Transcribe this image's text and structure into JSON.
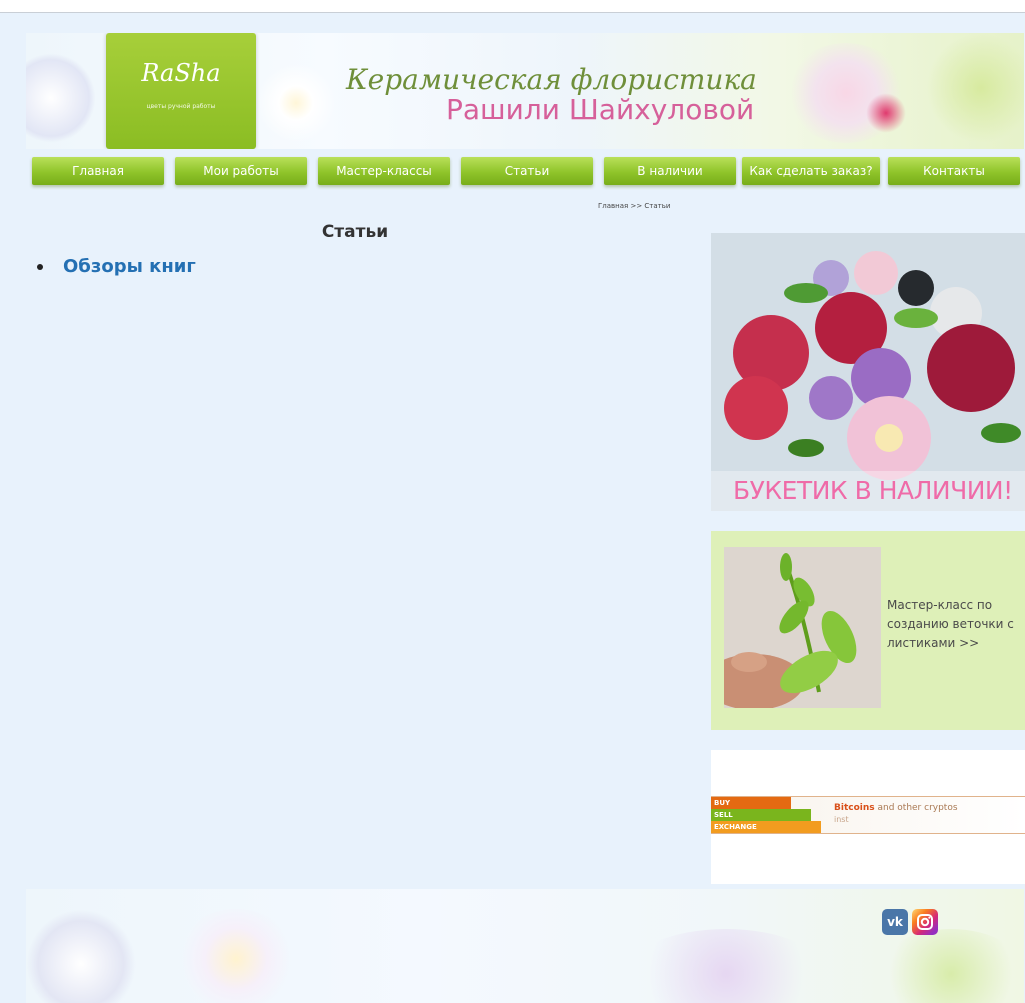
{
  "header": {
    "logo_text": "RaSha",
    "logo_subtitle": "цветы ручной работы",
    "title_line1": "Керамическая флористика",
    "title_line2": "Рашили Шайхуловой"
  },
  "nav": {
    "items": [
      {
        "label": "Главная"
      },
      {
        "label": "Мои работы"
      },
      {
        "label": "Мастер-классы"
      },
      {
        "label": "Статьи"
      },
      {
        "label": "В наличии"
      },
      {
        "label": "Как сделать заказ?"
      },
      {
        "label": "Контакты"
      }
    ]
  },
  "breadcrumb": "Главная >> Статьи",
  "main": {
    "title": "Статьи",
    "articles": [
      {
        "label": "Обзоры книг"
      }
    ]
  },
  "sidebar": {
    "promo1_caption": "БУКЕТИК В НАЛИЧИИ!",
    "promo2_text": "Мастер-класс по созданию веточки с листиками >>",
    "ad": {
      "tag_buy": "BUY",
      "tag_sell": "SELL",
      "tag_exchange": "EXCHANGE",
      "headline_bold": "Bitcoins",
      "headline_rest": " and other cryptos",
      "sub": "inst"
    }
  },
  "footer": {
    "social": [
      {
        "label": "vk",
        "icon": "vk-icon",
        "color": "#4a76a8"
      },
      {
        "label": "ig",
        "icon": "instagram-icon",
        "color": "#d6249f"
      }
    ]
  },
  "colors": {
    "accent_green": "#8fc42a",
    "link_blue": "#2470b3",
    "pink": "#d6609a",
    "page_bg": "#e8f2fc"
  }
}
